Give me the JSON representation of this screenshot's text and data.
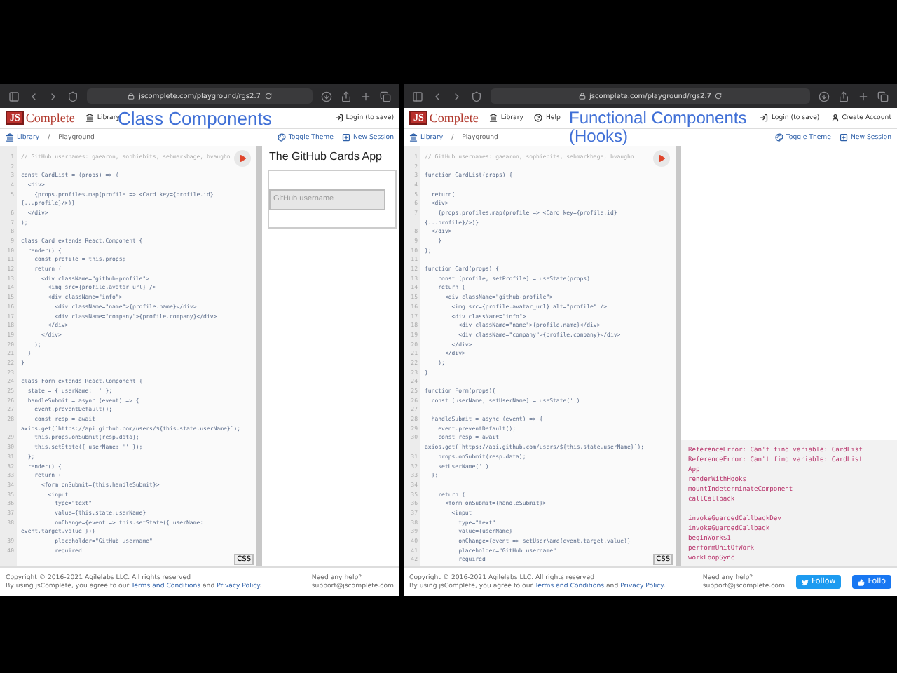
{
  "panes": [
    {
      "browser": {
        "url": "jscomplete.com/playground/rgs2.7"
      },
      "header": {
        "logo_mark": "JS",
        "logo_text": "Complete",
        "nav": [
          {
            "label": "Library",
            "kind": "library"
          }
        ],
        "actions": [
          {
            "label": "Login (to save)",
            "kind": "login"
          }
        ]
      },
      "overlay_title": "Class Components",
      "breadcrumb": {
        "items": [
          "Library",
          "Playground"
        ],
        "separator": "/"
      },
      "tools": [
        {
          "label": "Toggle Theme",
          "kind": "theme"
        },
        {
          "label": "New Session",
          "kind": "session"
        }
      ],
      "editor": {
        "css_button": "CSS",
        "lines": [
          {
            "number": "1",
            "text": "// GitHub usernames: gaearon, sophiebits, sebmarkbage, bvaughn",
            "kind": "comment"
          },
          {
            "number": "2"
          },
          {
            "number": "3",
            "text": "const CardList = (props) => ("
          },
          {
            "number": "4",
            "text": "  <div>"
          },
          {
            "number": "5",
            "text": "    {props.profiles.map(profile => <Card key={profile.id}"
          },
          {
            "text": "{...profile}/>)}"
          },
          {
            "number": "6",
            "text": "  </div>"
          },
          {
            "number": "7",
            "text": ");"
          },
          {
            "number": "8"
          },
          {
            "number": "9",
            "text": "class Card extends React.Component {"
          },
          {
            "number": "10",
            "text": "  render() {"
          },
          {
            "number": "11",
            "text": "    const profile = this.props;"
          },
          {
            "number": "12",
            "text": "    return ("
          },
          {
            "number": "13",
            "text": "      <div className=\"github-profile\">"
          },
          {
            "number": "14",
            "text": "        <img src={profile.avatar_url} />"
          },
          {
            "number": "15",
            "text": "        <div className=\"info\">"
          },
          {
            "number": "16",
            "text": "          <div className=\"name\">{profile.name}</div>"
          },
          {
            "number": "17",
            "text": "          <div className=\"company\">{profile.company}</div>"
          },
          {
            "number": "18",
            "text": "        </div>"
          },
          {
            "number": "19",
            "text": "      </div>"
          },
          {
            "number": "20",
            "text": "    );"
          },
          {
            "number": "21",
            "text": "  }"
          },
          {
            "number": "22",
            "text": "}"
          },
          {
            "number": "23"
          },
          {
            "number": "24",
            "text": "class Form extends React.Component {"
          },
          {
            "number": "25",
            "text": "  state = { userName: '' };"
          },
          {
            "number": "26",
            "text": "  handleSubmit = async (event) => {"
          },
          {
            "number": "27",
            "text": "    event.preventDefault();"
          },
          {
            "number": "28",
            "text": "    const resp = await"
          },
          {
            "text": "axios.get(`https://api.github.com/users/${this.state.userName}`);"
          },
          {
            "number": "29",
            "text": "    this.props.onSubmit(resp.data);"
          },
          {
            "number": "30",
            "text": "    this.setState({ userName: '' });"
          },
          {
            "number": "31",
            "text": "  };"
          },
          {
            "number": "32",
            "text": "  render() {"
          },
          {
            "number": "33",
            "text": "    return ("
          },
          {
            "number": "34",
            "text": "      <form onSubmit={this.handleSubmit}>"
          },
          {
            "number": "35",
            "text": "        <input"
          },
          {
            "number": "36",
            "text": "          type=\"text\""
          },
          {
            "number": "37",
            "text": "          value={this.state.userName}"
          },
          {
            "number": "38",
            "text": "          onChange={event => this.setState({ userName:"
          },
          {
            "text": "event.target.value })}"
          },
          {
            "number": "39",
            "text": "          placeholder=\"GitHub username\""
          },
          {
            "number": "40",
            "text": "          required"
          }
        ]
      },
      "preview": {
        "kind": "app",
        "title": "The GitHub Cards App",
        "placeholder": "GitHub username"
      },
      "footer": {
        "copyright": "Copyright © 2016-2021 Agilelabs LLC. All rights reserved",
        "legal": [
          {
            "text": "By using jsComplete, you agree to our ",
            "kind": "plain"
          },
          {
            "text": "Terms and Conditions",
            "kind": "link"
          },
          {
            "text": " and ",
            "kind": "plain"
          },
          {
            "text": "Privacy Policy",
            "kind": "link"
          },
          {
            "text": ".",
            "kind": "plain"
          }
        ],
        "help": "Need any help?",
        "email": "support@jscomplete.com"
      }
    },
    {
      "browser": {
        "url": "jscomplete.com/playground/rgs2.7"
      },
      "header": {
        "logo_mark": "JS",
        "logo_text": "Complete",
        "nav": [
          {
            "label": "Library",
            "kind": "library"
          },
          {
            "label": "Help",
            "kind": "help"
          }
        ],
        "actions": [
          {
            "label": "Login (to save)",
            "kind": "login"
          },
          {
            "label": "Create Account",
            "kind": "account"
          }
        ]
      },
      "overlay_title": "Functional Components (Hooks)",
      "breadcrumb": {
        "items": [
          "Library",
          "Playground"
        ],
        "separator": "/"
      },
      "tools": [
        {
          "label": "Toggle Theme",
          "kind": "theme"
        },
        {
          "label": "New Session",
          "kind": "session"
        }
      ],
      "editor": {
        "css_button": "CSS",
        "lines": [
          {
            "number": "1",
            "text": "// GitHub usernames: gaearon, sophiebits, sebmarkbage, bvaughn",
            "kind": "comment"
          },
          {
            "number": "2"
          },
          {
            "number": "3",
            "text": "function CardList(props) {"
          },
          {
            "number": "4"
          },
          {
            "number": "5",
            "text": "  return("
          },
          {
            "number": "6",
            "text": "  <div>"
          },
          {
            "number": "7",
            "text": "    {props.profiles.map(profile => <Card key={profile.id}"
          },
          {
            "text": "{...profile}/>)}"
          },
          {
            "number": "8",
            "text": "  </div>"
          },
          {
            "number": "9",
            "text": "    }"
          },
          {
            "number": "10",
            "text": "};"
          },
          {
            "number": "11"
          },
          {
            "number": "12",
            "text": "function Card(props) {"
          },
          {
            "number": "13",
            "text": "    const [profile, setProfile] = useState(props)"
          },
          {
            "number": "14",
            "text": "    return ("
          },
          {
            "number": "15",
            "text": "      <div className=\"github-profile\">"
          },
          {
            "number": "16",
            "text": "        <img src={profile.avatar_url} alt=\"profile\" />"
          },
          {
            "number": "17",
            "text": "        <div className=\"info\">"
          },
          {
            "number": "18",
            "text": "          <div className=\"name\">{profile.name}</div>"
          },
          {
            "number": "19",
            "text": "          <div className=\"company\">{profile.company}</div>"
          },
          {
            "number": "20",
            "text": "        </div>"
          },
          {
            "number": "21",
            "text": "      </div>"
          },
          {
            "number": "22",
            "text": "    );"
          },
          {
            "number": "23",
            "text": "}"
          },
          {
            "number": "24"
          },
          {
            "number": "25",
            "text": "function Form(props){"
          },
          {
            "number": "26",
            "text": "  const [userName, setUserName] = useState('')"
          },
          {
            "number": "27"
          },
          {
            "number": "28",
            "text": "  handleSubmit = async (event) => {"
          },
          {
            "number": "29",
            "text": "    event.preventDefault();"
          },
          {
            "number": "30",
            "text": "    const resp = await"
          },
          {
            "text": "axios.get(`https://api.github.com/users/${this.state.userName}`);"
          },
          {
            "number": "31",
            "text": "    props.onSubmit(resp.data);"
          },
          {
            "number": "32",
            "text": "    setUserName('')"
          },
          {
            "number": "33",
            "text": "  };"
          },
          {
            "number": "34"
          },
          {
            "number": "35",
            "text": "    return ("
          },
          {
            "number": "36",
            "text": "      <form onSubmit={handleSubmit}>"
          },
          {
            "number": "37",
            "text": "        <input"
          },
          {
            "number": "38",
            "text": "          type=\"text\""
          },
          {
            "number": "39",
            "text": "          value={userName}"
          },
          {
            "number": "40",
            "text": "          onChange={event => setUserName(event.target.value)}"
          },
          {
            "number": "41",
            "text": "          placeholder=\"GitHub username\""
          },
          {
            "number": "42",
            "text": "          required"
          }
        ]
      },
      "preview": {
        "kind": "console",
        "groups": [
          [
            "ReferenceError: Can't find variable: CardList",
            "ReferenceError: Can't find variable: CardList",
            "App",
            "renderWithHooks",
            "mountIndeterminateComponent",
            "callCallback"
          ],
          [
            "invokeGuardedCallbackDev",
            "invokeGuardedCallback",
            "beginWork$1",
            "performUnitOfWork",
            "workLoopSync"
          ]
        ]
      },
      "footer": {
        "copyright": "Copyright © 2016-2021 Agilelabs LLC. All rights reserved",
        "legal": [
          {
            "text": "By using jsComplete, you agree to our ",
            "kind": "plain"
          },
          {
            "text": "Terms and Conditions",
            "kind": "link"
          },
          {
            "text": " and ",
            "kind": "plain"
          },
          {
            "text": "Privacy Policy",
            "kind": "link"
          },
          {
            "text": ".",
            "kind": "plain"
          }
        ],
        "help": "Need any help?",
        "email": "support@jscomplete.com",
        "follow": [
          {
            "label": "Follow",
            "kind": "twitter"
          },
          {
            "label": "Follo",
            "kind": "facebook"
          }
        ]
      }
    }
  ]
}
